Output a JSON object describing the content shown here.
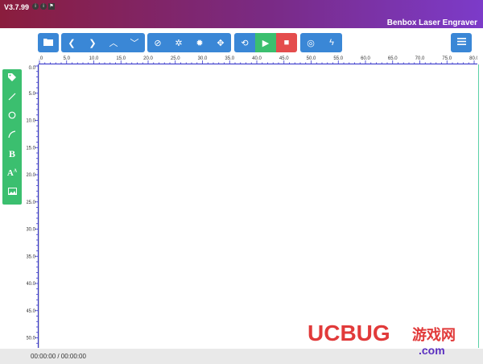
{
  "window": {
    "version": "V3.7.99",
    "title": "Benbox Laser Engraver"
  },
  "titlebar_icons": [
    "info-circle-icon",
    "info-circle-icon",
    "flag-icon"
  ],
  "toolbar": {
    "groups": [
      [
        {
          "name": "open-file-button",
          "icon": "folder-icon"
        }
      ],
      [
        {
          "name": "move-left-button",
          "icon": "chevron-left-icon"
        },
        {
          "name": "move-right-button",
          "icon": "chevron-right-icon"
        },
        {
          "name": "move-up-button",
          "icon": "chevron-up-icon"
        },
        {
          "name": "move-down-button",
          "icon": "chevron-down-icon"
        }
      ],
      [
        {
          "name": "cancel-button",
          "icon": "ban-icon"
        },
        {
          "name": "setting-a-button",
          "icon": "gear-small-icon"
        },
        {
          "name": "setting-b-button",
          "icon": "gear-large-icon"
        },
        {
          "name": "locate-button",
          "icon": "crosshair-icon"
        }
      ],
      [
        {
          "name": "repeat-button",
          "icon": "repeat-icon"
        },
        {
          "name": "play-button",
          "icon": "play-icon"
        },
        {
          "name": "stop-button",
          "icon": "stop-icon"
        }
      ],
      [
        {
          "name": "target-button",
          "icon": "target-icon"
        },
        {
          "name": "power-button",
          "icon": "bolt-icon"
        }
      ]
    ],
    "menu_icon": "hamburger-menu-icon"
  },
  "sidebar": {
    "items": [
      {
        "name": "tag-tool",
        "icon": "tag-icon"
      },
      {
        "name": "line-tool",
        "icon": "line-icon"
      },
      {
        "name": "circle-tool",
        "icon": "circle-icon"
      },
      {
        "name": "curve-tool",
        "icon": "curve-icon"
      },
      {
        "name": "bold-text-tool",
        "icon": "bold-icon",
        "label": "B"
      },
      {
        "name": "font-tool",
        "icon": "font-size-icon",
        "label": "A"
      },
      {
        "name": "image-tool",
        "icon": "image-icon"
      }
    ]
  },
  "ruler": {
    "x_labels": [
      "0.0",
      "5.0",
      "10.0",
      "15.0",
      "20.0",
      "25.0",
      "30.0",
      "35.0",
      "40.0",
      "45.0",
      "50.0",
      "55.0",
      "60.0",
      "65.0",
      "70.0",
      "75.0",
      "80.0"
    ],
    "y_labels": [
      "0.0",
      "5.0",
      "10.0",
      "15.0",
      "20.0",
      "25.0",
      "30.0",
      "35.0",
      "40.0",
      "45.0",
      "50.0"
    ]
  },
  "status": {
    "time": "00:00:00 / 00:00:00"
  },
  "watermark": {
    "brand": "UCBUG",
    "chinese": "游戏网",
    "domain": ".com"
  },
  "colors": {
    "toolbar_blue": "#3a87d6",
    "green": "#3bbf6f",
    "red": "#e44d4d",
    "ruler": "#3a3acc"
  }
}
